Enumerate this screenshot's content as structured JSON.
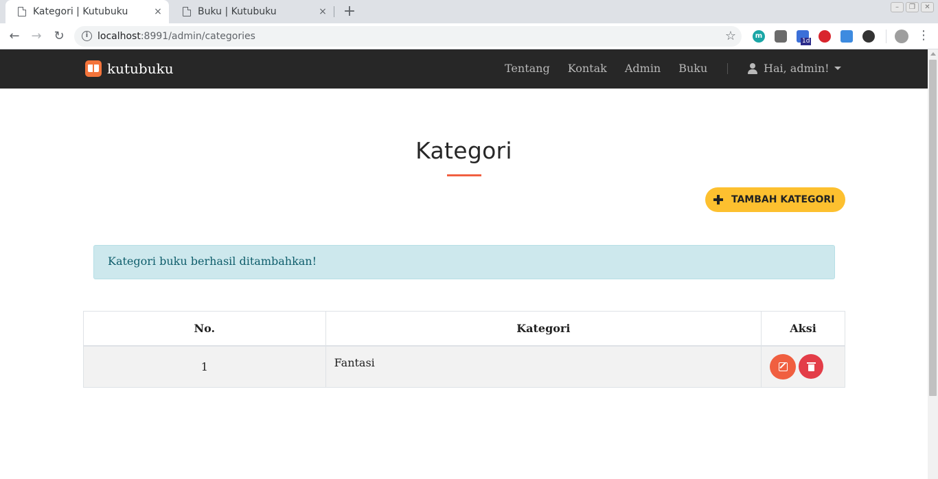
{
  "browser": {
    "tabs": [
      {
        "title": "Kategori | Kutubuku",
        "close": "×"
      },
      {
        "title": "Buku | Kutubuku",
        "close": "×"
      }
    ],
    "new_tab": "+",
    "url_host": "localhost",
    "url_rest": ":8991/admin/categories",
    "extension_badge": "1d",
    "ext_icon_m": "m"
  },
  "nav": {
    "brand": "kutubuku",
    "links": [
      "Tentang",
      "Kontak",
      "Admin",
      "Buku"
    ],
    "user_greeting": "Hai, admin!"
  },
  "page": {
    "title": "Kategori",
    "add_button_label": "TAMBAH KATEGORI",
    "alert_message": "Kategori buku berhasil ditambahkan!"
  },
  "table": {
    "headers": [
      "No.",
      "Kategori",
      "Aksi"
    ],
    "rows": [
      {
        "no": "1",
        "name": "Fantasi"
      }
    ]
  },
  "colors": {
    "navbar": "#272727",
    "accent": "#f05f40",
    "add_button": "#fdc02f",
    "alert_bg": "#cde8ed",
    "delete": "#e33d48"
  }
}
